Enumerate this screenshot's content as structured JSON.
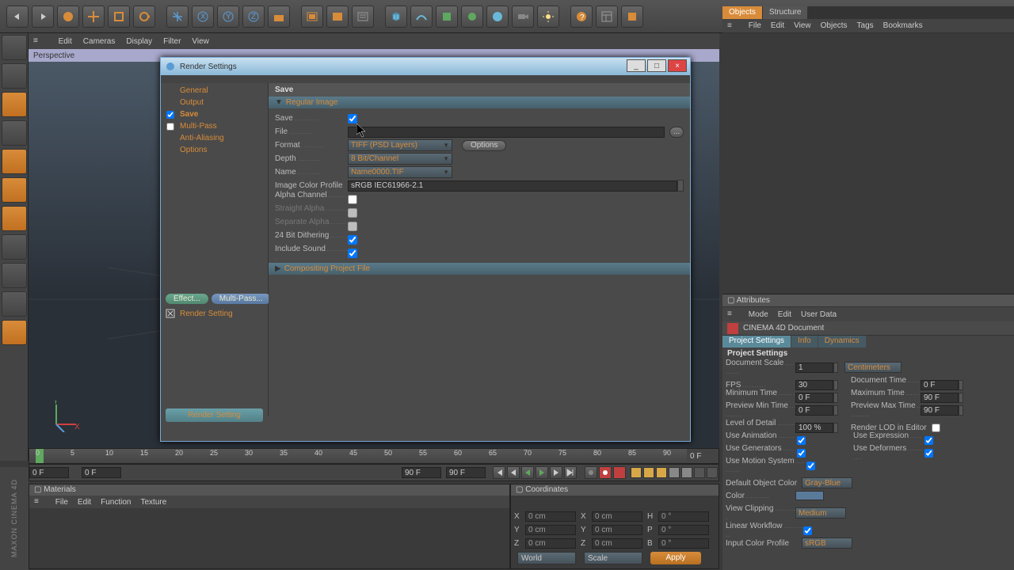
{
  "viewport": {
    "menus": [
      "Edit",
      "Cameras",
      "Display",
      "Filter",
      "View"
    ],
    "title": "Perspective"
  },
  "render_dialog": {
    "title": "Render Settings",
    "sidebar": [
      "General",
      "Output",
      "Save",
      "Multi-Pass",
      "Anti-Aliasing",
      "Options"
    ],
    "effect_btn": "Effect...",
    "multipass_btn": "Multi-Pass...",
    "render_setting_label": "Render Setting",
    "bottom_btn": "Render Setting",
    "content": {
      "section": "Save",
      "header1": "Regular Image",
      "save_label": "Save",
      "file_label": "File",
      "file_value": "",
      "format_label": "Format",
      "format_value": "TIFF (PSD Layers)",
      "options_btn": "Options",
      "depth_label": "Depth",
      "depth_value": "8 Bit/Channel",
      "name_label": "Name",
      "name_value": "Name0000.TIF",
      "profile_label": "Image Color Profile",
      "profile_value": "sRGB IEC61966-2.1",
      "alpha_label": "Alpha Channel",
      "straight_label": "Straight Alpha",
      "separate_label": "Separate Alpha",
      "dither_label": "24 Bit Dithering",
      "sound_label": "Include Sound",
      "header2": "Compositing Project File"
    }
  },
  "objects_panel": {
    "tabs": [
      "Objects",
      "Structure"
    ],
    "menus": [
      "File",
      "Edit",
      "View",
      "Objects",
      "Tags",
      "Bookmarks"
    ]
  },
  "attributes": {
    "header": "Attributes",
    "menus": [
      "Mode",
      "Edit",
      "User Data"
    ],
    "doc_name": "CINEMA 4D Document",
    "subtabs": [
      "Project Settings",
      "Info",
      "Dynamics"
    ],
    "section": "Project Settings",
    "doc_scale_label": "Document Scale",
    "doc_scale_value": "1",
    "doc_scale_unit": "Centimeters",
    "fps_label": "FPS",
    "fps_value": "30",
    "doc_time_label": "Document Time",
    "doc_time_value": "0 F",
    "min_time_label": "Minimum Time",
    "min_time_value": "0 F",
    "max_time_label": "Maximum Time",
    "max_time_value": "90 F",
    "prev_min_label": "Preview Min Time",
    "prev_min_value": "0 F",
    "prev_max_label": "Preview Max Time",
    "prev_max_value": "90 F",
    "lod_label": "Level of Detail",
    "lod_value": "100 %",
    "lod_editor_label": "Render LOD in Editor",
    "use_anim_label": "Use Animation",
    "use_expr_label": "Use Expression",
    "use_gen_label": "Use Generators",
    "use_def_label": "Use Deformers",
    "use_motion_label": "Use Motion System",
    "def_color_label": "Default Object Color",
    "def_color_value": "Gray-Blue",
    "color_label": "Color",
    "view_clip_label": "View Clipping",
    "view_clip_value": "Medium",
    "linear_wf_label": "Linear Workflow",
    "input_profile_label": "Input Color Profile",
    "input_profile_value": "sRGB"
  },
  "timeline": {
    "ticks": [
      "0",
      "5",
      "10",
      "15",
      "20",
      "25",
      "30",
      "35",
      "40",
      "45",
      "50",
      "55",
      "60",
      "65",
      "70",
      "75",
      "80",
      "85",
      "90"
    ],
    "end": "0 F",
    "start_field": "0 F",
    "pos_field": "0 F",
    "right_field1": "90 F",
    "right_field2": "90 F"
  },
  "materials": {
    "header": "Materials",
    "menus": [
      "File",
      "Edit",
      "Function",
      "Texture"
    ]
  },
  "coords": {
    "header": "Coordinates",
    "rows": [
      {
        "l1": "X",
        "v1": "0 cm",
        "l2": "X",
        "v2": "0 cm",
        "l3": "H",
        "v3": "0 °"
      },
      {
        "l1": "Y",
        "v1": "0 cm",
        "l2": "Y",
        "v2": "0 cm",
        "l3": "P",
        "v3": "0 °"
      },
      {
        "l1": "Z",
        "v1": "0 cm",
        "l2": "Z",
        "v2": "0 cm",
        "l3": "B",
        "v3": "0 °"
      }
    ],
    "sel1": "World",
    "sel2": "Scale",
    "apply": "Apply"
  },
  "brand": "MAXON CINEMA 4D"
}
